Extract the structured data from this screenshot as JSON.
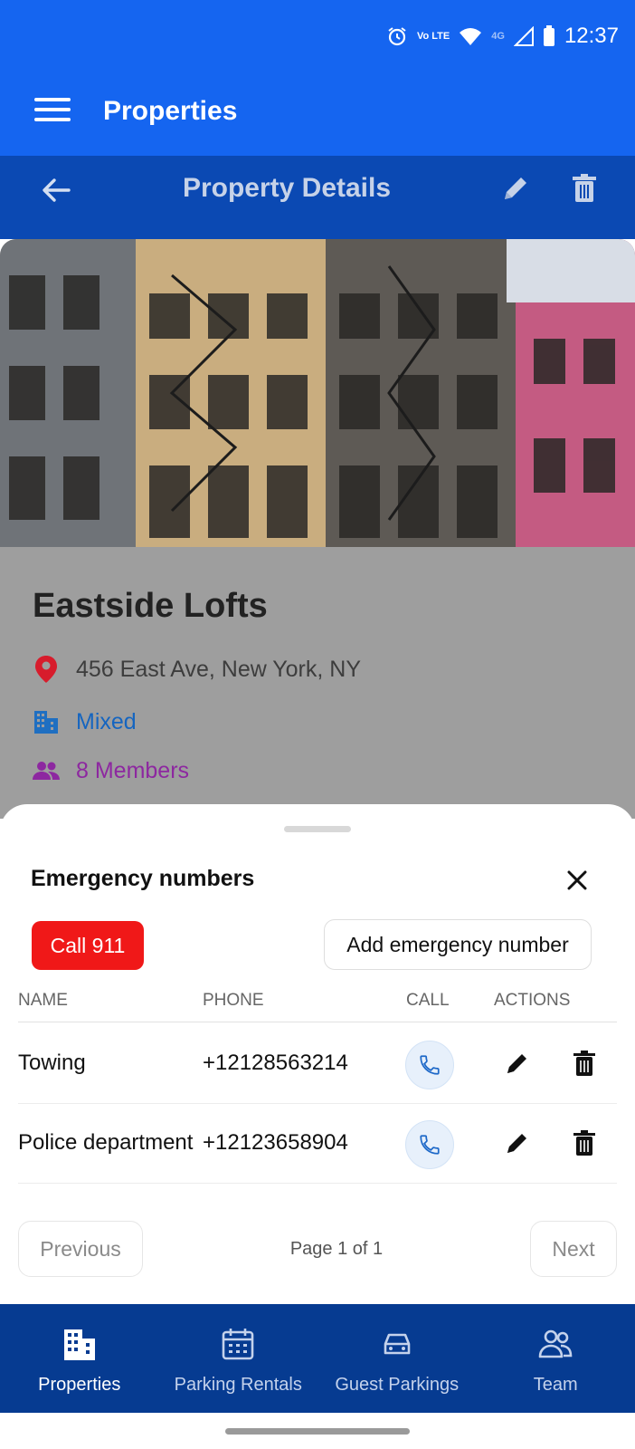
{
  "status_bar": {
    "time": "12:37",
    "network": "Vo LTE",
    "signal": "4G"
  },
  "app_bar": {
    "title": "Properties"
  },
  "sub_header": {
    "title": "Property Details"
  },
  "property": {
    "name": "Eastside Lofts",
    "address": "456 East Ave, New York, NY",
    "type": "Mixed",
    "members": "8 Members"
  },
  "sheet": {
    "title": "Emergency numbers",
    "call_911_label": "Call 911",
    "add_label": "Add emergency number",
    "columns": {
      "name": "NAME",
      "phone": "PHONE",
      "call": "CALL",
      "actions": "ACTIONS"
    },
    "rows": [
      {
        "name": "Towing",
        "phone": "+12128563214"
      },
      {
        "name": "Police department",
        "phone": "+12123658904"
      }
    ],
    "pagination": {
      "previous": "Previous",
      "page_info": "Page 1 of 1",
      "next": "Next"
    }
  },
  "bottom_nav": {
    "items": [
      {
        "label": "Properties",
        "icon": "building-icon",
        "active": true
      },
      {
        "label": "Parking Rentals",
        "icon": "calendar-icon",
        "active": false
      },
      {
        "label": "Guest Parkings",
        "icon": "car-icon",
        "active": false
      },
      {
        "label": "Team",
        "icon": "team-icon",
        "active": false
      }
    ]
  },
  "colors": {
    "app_bar": "#1565f0",
    "sub_header": "#0b49b3",
    "bottom_nav": "#063b91",
    "call_911": "#f01818",
    "type_text": "#1565c0",
    "members_text": "#8d28a0"
  }
}
